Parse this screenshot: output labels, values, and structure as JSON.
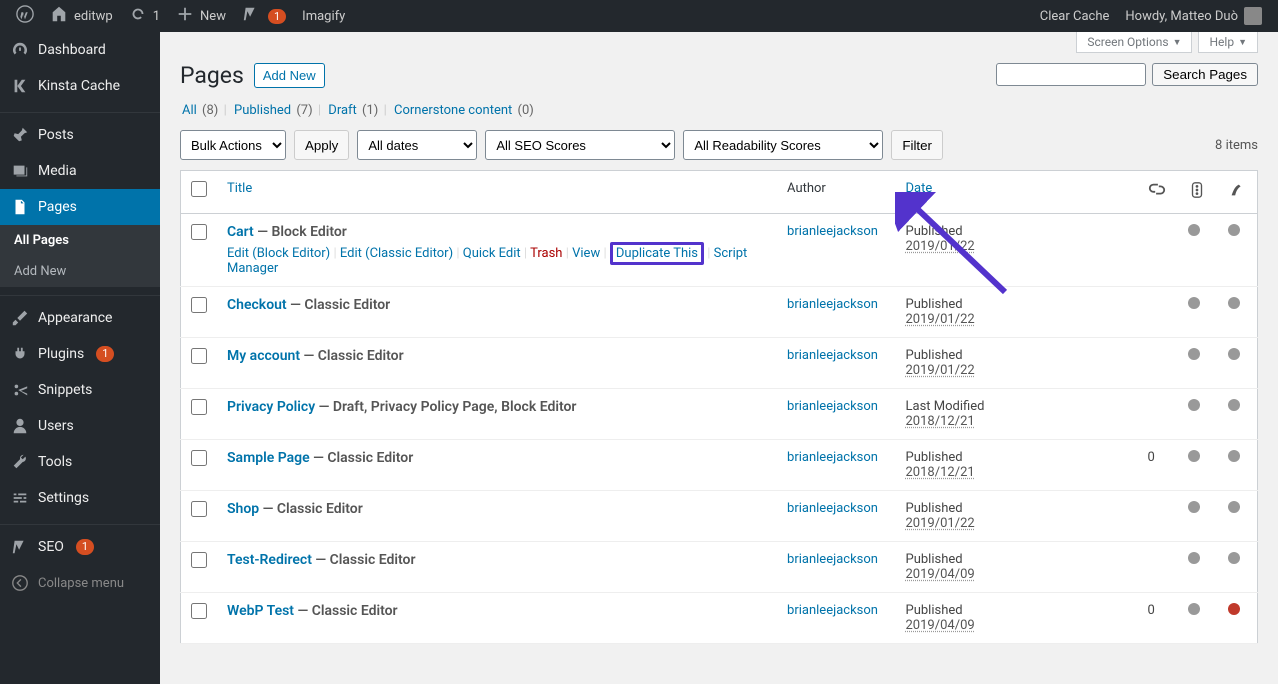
{
  "adminbar": {
    "site": "editwp",
    "updates": "1",
    "new": "New",
    "imagify": "Imagify",
    "imagify_badge": "1",
    "clear_cache": "Clear Cache",
    "howdy": "Howdy, Matteo Duò"
  },
  "sidebar": {
    "dashboard": "Dashboard",
    "kinsta": "Kinsta Cache",
    "posts": "Posts",
    "media": "Media",
    "pages": "Pages",
    "sub_all": "All Pages",
    "sub_add": "Add New",
    "appearance": "Appearance",
    "plugins": "Plugins",
    "plugins_badge": "1",
    "snippets": "Snippets",
    "users": "Users",
    "tools": "Tools",
    "settings": "Settings",
    "seo": "SEO",
    "seo_badge": "1",
    "collapse": "Collapse menu"
  },
  "screen": {
    "options": "Screen Options",
    "help": "Help"
  },
  "header": {
    "title": "Pages",
    "add_new": "Add New"
  },
  "views": {
    "all": "All",
    "all_count": "(8)",
    "published": "Published",
    "published_count": "(7)",
    "draft": "Draft",
    "draft_count": "(1)",
    "cornerstone": "Cornerstone content",
    "cornerstone_count": "(0)"
  },
  "search": {
    "button": "Search Pages"
  },
  "nav": {
    "bulk": "Bulk Actions",
    "apply": "Apply",
    "dates": "All dates",
    "seo_scores": "All SEO Scores",
    "readability": "All Readability Scores",
    "filter": "Filter",
    "count": "8 items"
  },
  "columns": {
    "title": "Title",
    "author": "Author",
    "date": "Date"
  },
  "row_actions": {
    "edit_block": "Edit (Block Editor)",
    "edit_classic": "Edit (Classic Editor)",
    "quick": "Quick Edit",
    "trash": "Trash",
    "view": "View",
    "duplicate": "Duplicate This",
    "script": "Script Manager"
  },
  "rows": [
    {
      "title": "Cart",
      "state": " — Block Editor",
      "author": "brianleejackson",
      "date_label": "Published",
      "date": "2019/01/22",
      "comments": "",
      "seo": "grey",
      "read": "grey",
      "show_actions": true
    },
    {
      "title": "Checkout",
      "state": " — Classic Editor",
      "author": "brianleejackson",
      "date_label": "Published",
      "date": "2019/01/22",
      "comments": "",
      "seo": "grey",
      "read": "grey"
    },
    {
      "title": "My account",
      "state": " — Classic Editor",
      "author": "brianleejackson",
      "date_label": "Published",
      "date": "2019/01/22",
      "comments": "",
      "seo": "grey",
      "read": "grey"
    },
    {
      "title": "Privacy Policy",
      "state": " — Draft, Privacy Policy Page, Block Editor",
      "author": "brianleejackson",
      "date_label": "Last Modified",
      "date": "2018/12/21",
      "comments": "",
      "seo": "grey",
      "read": "grey"
    },
    {
      "title": "Sample Page",
      "state": " — Classic Editor",
      "author": "brianleejackson",
      "date_label": "Published",
      "date": "2018/12/21",
      "comments": "0",
      "seo": "grey",
      "read": "grey"
    },
    {
      "title": "Shop",
      "state": " — Classic Editor",
      "author": "brianleejackson",
      "date_label": "Published",
      "date": "2019/01/22",
      "comments": "",
      "seo": "grey",
      "read": "grey"
    },
    {
      "title": "Test-Redirect",
      "state": " — Classic Editor",
      "author": "brianleejackson",
      "date_label": "Published",
      "date": "2019/04/09",
      "comments": "",
      "seo": "grey",
      "read": "grey"
    },
    {
      "title": "WebP Test",
      "state": " — Classic Editor",
      "author": "brianleejackson",
      "date_label": "Published",
      "date": "2019/04/09",
      "comments": "0",
      "seo": "grey",
      "read": "red"
    }
  ]
}
